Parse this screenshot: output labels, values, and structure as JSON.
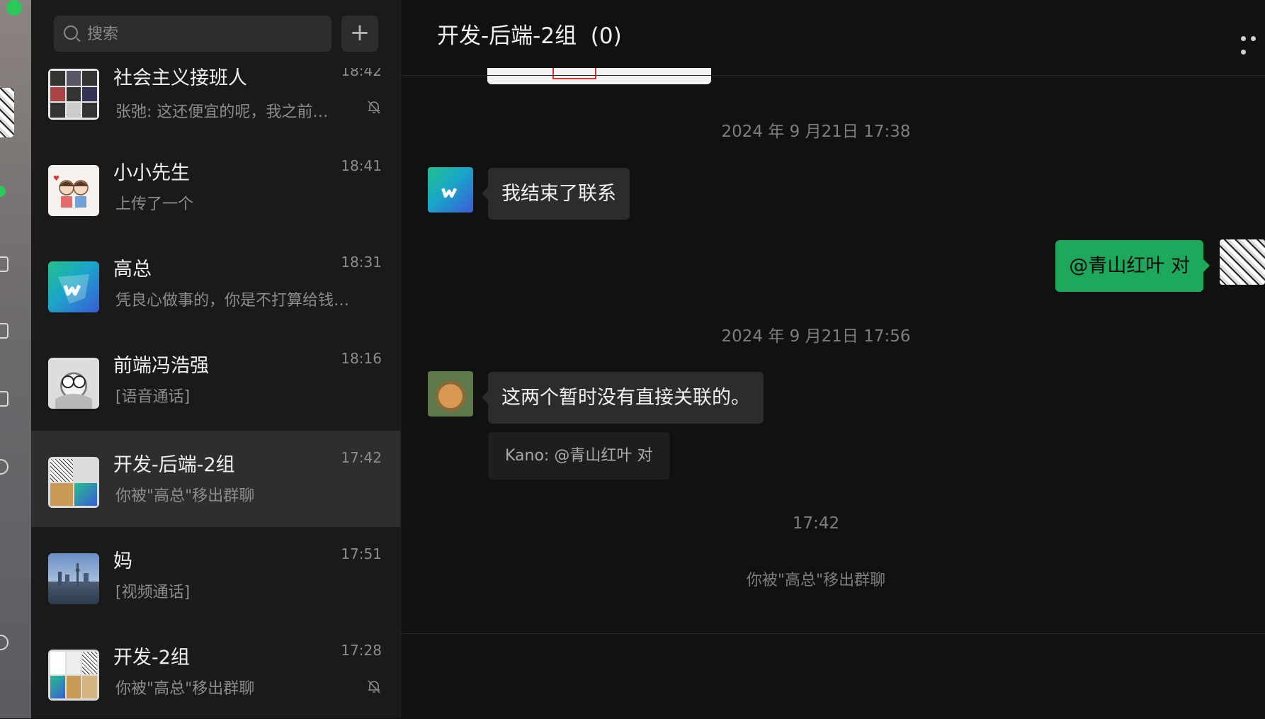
{
  "search": {
    "placeholder": "搜索"
  },
  "add_label": "+",
  "conversations": [
    {
      "name": "社会主义接班人",
      "time": "18:42",
      "preview": "张弛: 这还便宜的呢，我之前…",
      "muted": true
    },
    {
      "name": "小小先生",
      "time": "18:41",
      "preview": "上传了一个",
      "muted": false
    },
    {
      "name": "高总",
      "time": "18:31",
      "preview": "凭良心做事的，你是不打算给钱…",
      "muted": false
    },
    {
      "name": "前端冯浩强",
      "time": "18:16",
      "preview": "[语音通话]",
      "muted": false
    },
    {
      "name": "开发-后端-2组",
      "time": "17:42",
      "preview": "你被\"高总\"移出群聊",
      "muted": false,
      "active": true
    },
    {
      "name": "妈",
      "time": "17:51",
      "preview": "[视频通话]",
      "muted": false
    },
    {
      "name": "开发-2组",
      "time": "17:28",
      "preview": "你被\"高总\"移出群聊",
      "muted": true
    }
  ],
  "chat": {
    "title": "开发-后端-2组  (0)",
    "messages": [
      {
        "type": "time",
        "text": "2024 年 9 月21日 17:38"
      },
      {
        "type": "incoming",
        "text": "我结束了联系"
      },
      {
        "type": "outgoing",
        "text": "@青山红叶 对"
      },
      {
        "type": "time",
        "text": "2024 年 9 月21日 17:56"
      },
      {
        "type": "incoming",
        "text": "这两个暂时没有直接关联的。",
        "quote": "Kano: @青山红叶 对"
      },
      {
        "type": "time",
        "text": "17:42"
      },
      {
        "type": "system",
        "text": "你被\"高总\"移出群聊"
      }
    ]
  },
  "colors": {
    "accent": "#1ea85c",
    "online_dot": "#2bc85a",
    "background": "#111111",
    "sidebar": "#1a1a1a"
  }
}
